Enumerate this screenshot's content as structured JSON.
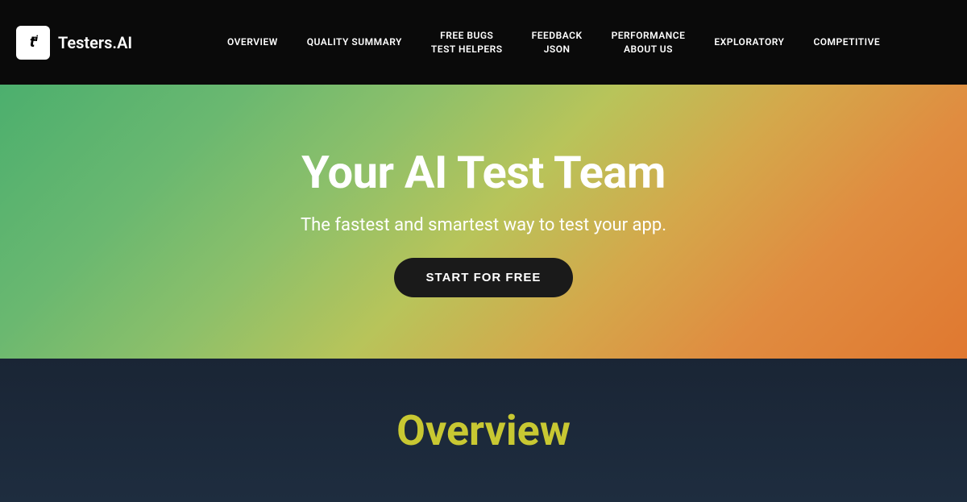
{
  "header": {
    "logo_icon": "tai",
    "logo_text": "Testers.AI",
    "nav_items": [
      {
        "id": "overview",
        "label": "OVERVIEW",
        "line2": null
      },
      {
        "id": "quality-summary",
        "label": "QUALITY SUMMARY",
        "line2": null
      },
      {
        "id": "free-bugs",
        "label": "FREE BUGS",
        "line2": "TEST HELPERS"
      },
      {
        "id": "feedback-json",
        "label": "FEEDBACK",
        "line2": "JSON"
      },
      {
        "id": "performance",
        "label": "PERFORMANCE",
        "line2": "About Us"
      },
      {
        "id": "exploratory",
        "label": "EXPLORATORY",
        "line2": null
      },
      {
        "id": "competitive",
        "label": "COMPETITIVE",
        "line2": null
      }
    ]
  },
  "hero": {
    "title": "Your AI Test Team",
    "subtitle": "The fastest and smartest way to test your app.",
    "cta_label": "START FOR FREE"
  },
  "bottom": {
    "section_title": "Overview"
  }
}
